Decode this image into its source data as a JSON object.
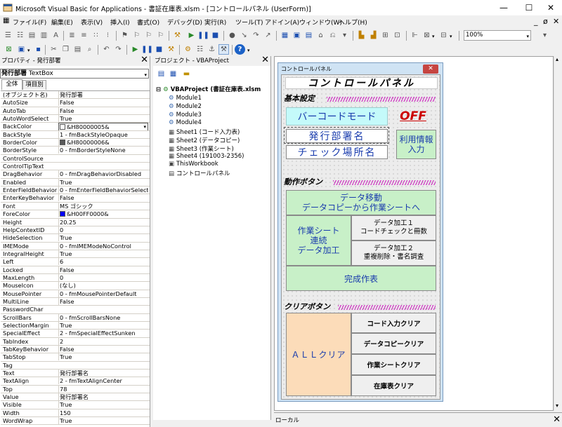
{
  "window": {
    "title": "Microsoft Visual Basic for Applications - 書証在庫表.xlsm - [コントロールパネル (UserForm)]",
    "controls": [
      "—",
      "☐",
      "✕"
    ]
  },
  "menu": {
    "items": [
      "ファイル(F)",
      "編集(E)",
      "表示(V)",
      "挿入(I)",
      "書式(O)",
      "デバッグ(D)",
      "実行(R)",
      "ツール(T)",
      "アドイン(A)",
      "ウィンドウ(W)",
      "ヘルプ(H)"
    ],
    "mdi_controls": [
      "_",
      "ø",
      "✕"
    ]
  },
  "toolbar": {
    "zoom": "100%"
  },
  "properties_panel": {
    "title": "プロパティ - 発行部署",
    "object_name": "発行部署",
    "object_type": "TextBox",
    "tabs": [
      "全体",
      "項目別"
    ],
    "rows": [
      {
        "name": "(オブジェクト名)",
        "value": "発行部署"
      },
      {
        "name": "AutoSize",
        "value": "False"
      },
      {
        "name": "AutoTab",
        "value": "False"
      },
      {
        "name": "AutoWordSelect",
        "value": "True"
      },
      {
        "name": "BackColor",
        "value": "&H80000005&",
        "swatch": "#ffffff"
      },
      {
        "name": "BackStyle",
        "value": "1 - fmBackStyleOpaque"
      },
      {
        "name": "BorderColor",
        "value": "&H80000006&",
        "swatch": "#595959"
      },
      {
        "name": "BorderStyle",
        "value": "0 - fmBorderStyleNone"
      },
      {
        "name": "ControlSource",
        "value": ""
      },
      {
        "name": "ControlTipText",
        "value": ""
      },
      {
        "name": "DragBehavior",
        "value": "0 - fmDragBehaviorDisabled"
      },
      {
        "name": "Enabled",
        "value": "True"
      },
      {
        "name": "EnterFieldBehavior",
        "value": "0 - fmEnterFieldBehaviorSelectA"
      },
      {
        "name": "EnterKeyBehavior",
        "value": "False"
      },
      {
        "name": "Font",
        "value": "MS ゴシック"
      },
      {
        "name": "ForeColor",
        "value": "&H00FF0000&",
        "swatch": "#0000ff"
      },
      {
        "name": "Height",
        "value": "20.25"
      },
      {
        "name": "HelpContextID",
        "value": "0"
      },
      {
        "name": "HideSelection",
        "value": "True"
      },
      {
        "name": "IMEMode",
        "value": "0 - fmIMEModeNoControl"
      },
      {
        "name": "IntegralHeight",
        "value": "True"
      },
      {
        "name": "Left",
        "value": "6"
      },
      {
        "name": "Locked",
        "value": "False"
      },
      {
        "name": "MaxLength",
        "value": "0"
      },
      {
        "name": "MouseIcon",
        "value": "(なし)"
      },
      {
        "name": "MousePointer",
        "value": "0 - fmMousePointerDefault"
      },
      {
        "name": "MultiLine",
        "value": "False"
      },
      {
        "name": "PasswordChar",
        "value": ""
      },
      {
        "name": "ScrollBars",
        "value": "0 - fmScrollBarsNone"
      },
      {
        "name": "SelectionMargin",
        "value": "True"
      },
      {
        "name": "SpecialEffect",
        "value": "2 - fmSpecialEffectSunken"
      },
      {
        "name": "TabIndex",
        "value": "2"
      },
      {
        "name": "TabKeyBehavior",
        "value": "False"
      },
      {
        "name": "TabStop",
        "value": "True"
      },
      {
        "name": "Tag",
        "value": ""
      },
      {
        "name": "Text",
        "value": "発行部署名"
      },
      {
        "name": "TextAlign",
        "value": "2 - fmTextAlignCenter"
      },
      {
        "name": "Top",
        "value": "78"
      },
      {
        "name": "Value",
        "value": "発行部署名"
      },
      {
        "name": "Visible",
        "value": "True"
      },
      {
        "name": "Width",
        "value": "150"
      },
      {
        "name": "WordWrap",
        "value": "True"
      }
    ]
  },
  "project_panel": {
    "title": "プロジェクト - VBAProject",
    "root": "VBAProject (書証在庫表.xlsm",
    "items": [
      {
        "label": "Module1",
        "icon": "module-icon"
      },
      {
        "label": "Module2",
        "icon": "module-icon"
      },
      {
        "label": "Module3",
        "icon": "module-icon"
      },
      {
        "label": "Module4",
        "icon": "module-icon"
      },
      {
        "label": "Sheet1 (コード入力表)",
        "icon": "sheet-icon"
      },
      {
        "label": "Sheet2 (データコピー)",
        "icon": "sheet-icon"
      },
      {
        "label": "Sheet3 (作業シート)",
        "icon": "sheet-icon"
      },
      {
        "label": "Sheet4 (191003-2356)",
        "icon": "sheet-icon"
      },
      {
        "label": "ThisWorkbook",
        "icon": "workbook-icon"
      },
      {
        "label": "コントロールパネル",
        "icon": "userform-icon"
      }
    ]
  },
  "userform": {
    "caption": "コントロールパネル",
    "heading": "コントロールパネル",
    "basic_label": "基本設定",
    "barcode_button": "バーコードモード",
    "off_label": "OFF",
    "dept_textbox": "発行部署名",
    "check_textbox": "チェック場所名",
    "use_info_button": "利用情報\n入力",
    "action_label": "動作ボタン",
    "move_button": "データ移動\nデータコピーから作業シートへ",
    "work_sheet_button": "作業シート\n連続\nデータ加工",
    "proc1_button": "データ加工１\nコードチェックと冊数",
    "proc2_button": "データ加工２\n重複削除・書名調査",
    "complete_button": "完成作表",
    "clear_label": "クリアボタン",
    "all_clear_button": "ＡＬＬクリア",
    "code_clear_button": "コード入力クリア",
    "copy_clear_button": "データコピークリア",
    "sheet_clear_button": "作業シートクリア",
    "stock_clear_button": "在庫表クリア"
  },
  "locals": {
    "title": "ローカル"
  },
  "colors": {
    "off_red": "#cc0000",
    "heading_blue": "#000090",
    "hatch": "#d13dc5",
    "light_green": "#c8f0c8",
    "peach": "#fcdcb9",
    "light_cyan": "#c4fafa"
  }
}
